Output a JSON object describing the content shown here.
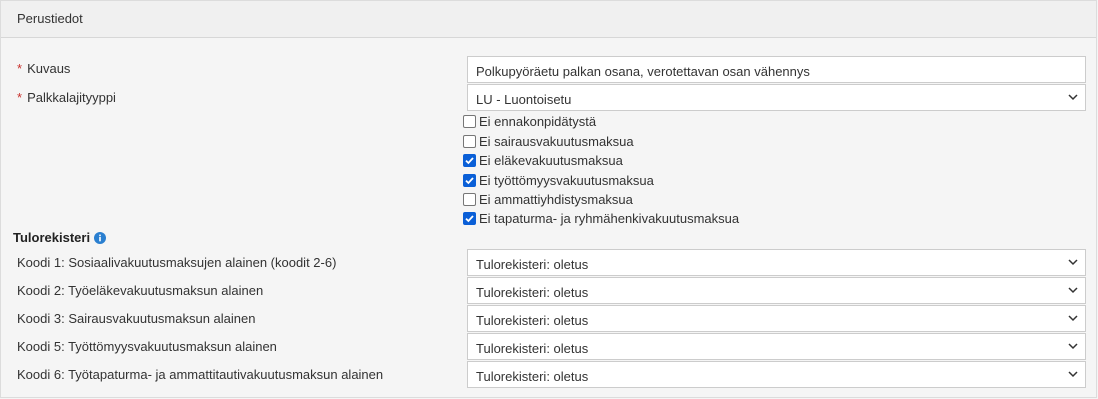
{
  "panel": {
    "title": "Perustiedot"
  },
  "basic": {
    "required_mark": "*",
    "kuvaus_label": "Kuvaus",
    "kuvaus_value": "Polkupyöräetu palkan osana, verotettavan osan vähennys",
    "palkkalaji_label": "Palkkalajityyppi",
    "palkkalaji_value": "LU - Luontoisetu"
  },
  "checkboxes": [
    {
      "label": "Ei ennakonpidätystä",
      "checked": false
    },
    {
      "label": "Ei sairausvakuutusmaksua",
      "checked": false
    },
    {
      "label": "Ei eläkevakuutusmaksua",
      "checked": true
    },
    {
      "label": "Ei työttömyysvakuutusmaksua",
      "checked": true
    },
    {
      "label": "Ei ammattiyhdistysmaksua",
      "checked": false
    },
    {
      "label": "Ei tapaturma- ja ryhmähenkivakuutusmaksua",
      "checked": true
    }
  ],
  "tulorekisteri": {
    "title": "Tulorekisteri",
    "info_icon": "info-circle-icon",
    "rows": [
      {
        "label": "Koodi 1: Sosiaalivakuutusmaksujen alainen (koodit 2-6)",
        "value": "Tulorekisteri: oletus"
      },
      {
        "label": "Koodi 2: Työeläkevakuutusmaksun alainen",
        "value": "Tulorekisteri: oletus"
      },
      {
        "label": "Koodi 3: Sairausvakuutusmaksun alainen",
        "value": "Tulorekisteri: oletus"
      },
      {
        "label": "Koodi 5: Työttömyysvakuutusmaksun alainen",
        "value": "Tulorekisteri: oletus"
      },
      {
        "label": "Koodi 6: Työtapaturma- ja ammattitautivakuutusmaksun alainen",
        "value": "Tulorekisteri: oletus"
      }
    ]
  },
  "colors": {
    "checkbox_checked": "#0a5fd7",
    "required": "#c9302c",
    "info": "#2a7fd0"
  }
}
